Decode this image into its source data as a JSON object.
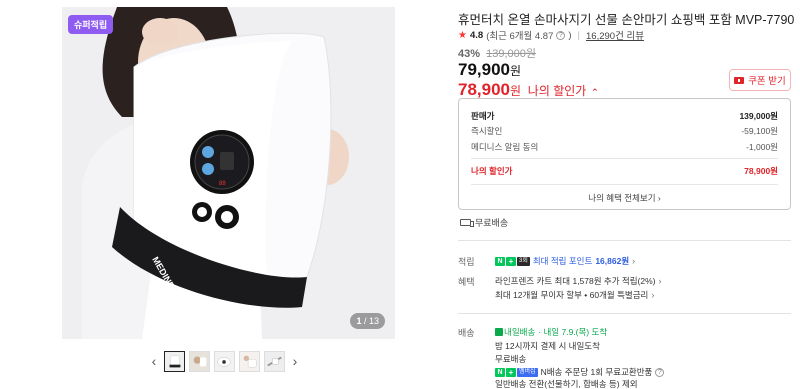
{
  "gallery": {
    "badge": "슈퍼적립",
    "counter_current": "1",
    "counter_total": "/ 13",
    "thumbnail_count": 5
  },
  "product": {
    "title": "휴먼터치 온열 손마사지기 선물 손안마기 쇼핑백 포함 MVP-7790",
    "rating_score": "4.8",
    "rating_sub": "(최근 6개월 4.87",
    "rating_sub_end": ")",
    "review_count": "16,290건 리뷰",
    "discount_pct": "43%",
    "original_price": "139,000원",
    "sale_price": "79,900",
    "my_price": "78,900",
    "won": "원",
    "my_price_label": "나의 할인가",
    "coupon_button": "쿠폰 받기"
  },
  "breakdown": {
    "rows": [
      {
        "label": "판매가",
        "value": "139,000원"
      },
      {
        "label": "즉시할인",
        "value": "-59,100원"
      },
      {
        "label": "메디니스 알림 동의",
        "value": "-1,000원"
      },
      {
        "label": "나의 할인가",
        "value": "78,900원"
      }
    ],
    "link": "나의 혜택 전체보기 ›"
  },
  "free_shipping": "무료배송",
  "points": {
    "label": "적립",
    "badge_tag": "3회",
    "text": "최대 적립 포인트",
    "amount": "16,862원",
    "chevron": "›"
  },
  "benefits": {
    "label": "혜택",
    "line1": "라인프렌즈 카트 최대 1,578원 추가 적립(2%)",
    "line2": "최대 12개월 무이자 할부 • 60개월 특별금리",
    "chevron": "›"
  },
  "delivery": {
    "label": "배송",
    "badge": "내일배송",
    "eta": "· 내일 7.9.(목) 도착",
    "line2": "밤 12시까지 결제 시 내일도착",
    "line3": "무료배송",
    "badge2_tag": "멤버십",
    "line4": "N배송 주문당 1회 무료교환반품",
    "line5": "일반배송 전환(선물하기, 합배송 등) 제외"
  },
  "colors": {
    "accent_red": "#e0242a",
    "naver_green": "#03c75a",
    "badge_purple": "#8e5cf0",
    "link_blue": "#2d5de0"
  }
}
